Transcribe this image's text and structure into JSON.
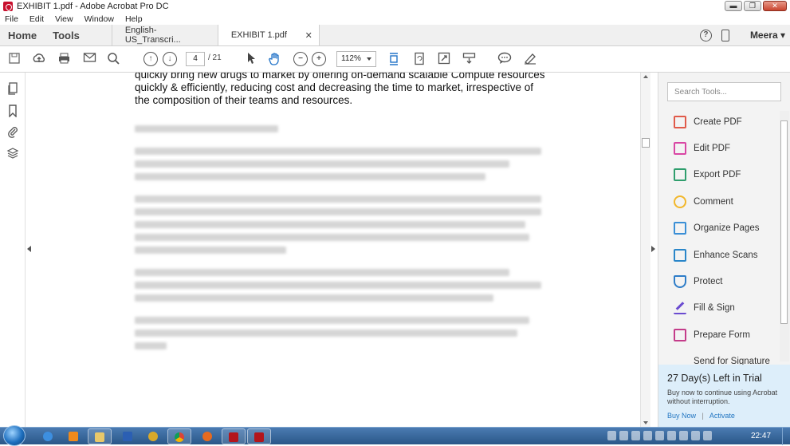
{
  "window": {
    "title": "EXHIBIT 1.pdf - Adobe Acrobat Pro DC",
    "minimize": "▬",
    "maximize": "❐",
    "close": "✕"
  },
  "menu": [
    "File",
    "Edit",
    "View",
    "Window",
    "Help"
  ],
  "tabs": {
    "home": "Home",
    "tools": "Tools",
    "documents": [
      {
        "label": "English-US_Transcri...",
        "active": false
      },
      {
        "label": "EXHIBIT 1.pdf",
        "active": true,
        "close": "✕"
      }
    ],
    "help_icon": "?",
    "user": "Meera",
    "user_caret": "▾"
  },
  "toolbar": {
    "page_current": "4",
    "page_total": "/ 21",
    "zoom": "112%"
  },
  "document": {
    "visible_text": "quickly bring new drugs to market by offering on-demand scalable Compute resources quickly & efficiently, reducing cost and decreasing the time to market, irrespective of the composition of their teams and resources."
  },
  "tools_pane": {
    "search_placeholder": "Search Tools...",
    "items": [
      {
        "label": "Create PDF",
        "icon": "create-pdf-icon"
      },
      {
        "label": "Edit PDF",
        "icon": "edit-pdf-icon"
      },
      {
        "label": "Export PDF",
        "icon": "export-pdf-icon"
      },
      {
        "label": "Comment",
        "icon": "comment-icon"
      },
      {
        "label": "Organize Pages",
        "icon": "organize-pages-icon"
      },
      {
        "label": "Enhance Scans",
        "icon": "enhance-scans-icon"
      },
      {
        "label": "Protect",
        "icon": "protect-icon"
      },
      {
        "label": "Fill & Sign",
        "icon": "fill-sign-icon"
      },
      {
        "label": "Prepare Form",
        "icon": "prepare-form-icon"
      },
      {
        "label": "Send for Signature",
        "icon": "send-signature-icon"
      }
    ],
    "trial": {
      "title": "27 Day(s) Left in Trial",
      "description": "Buy now to continue using Acrobat without interruption.",
      "buy_now": "Buy Now",
      "separator": "|",
      "activate": "Activate"
    }
  },
  "taskbar": {
    "clock": "22:47"
  },
  "colors": {
    "taskbar": "#2a5788",
    "trial_bg": "#ddeefa",
    "link": "#2276c2",
    "acrobat_red": "#c8102e"
  }
}
